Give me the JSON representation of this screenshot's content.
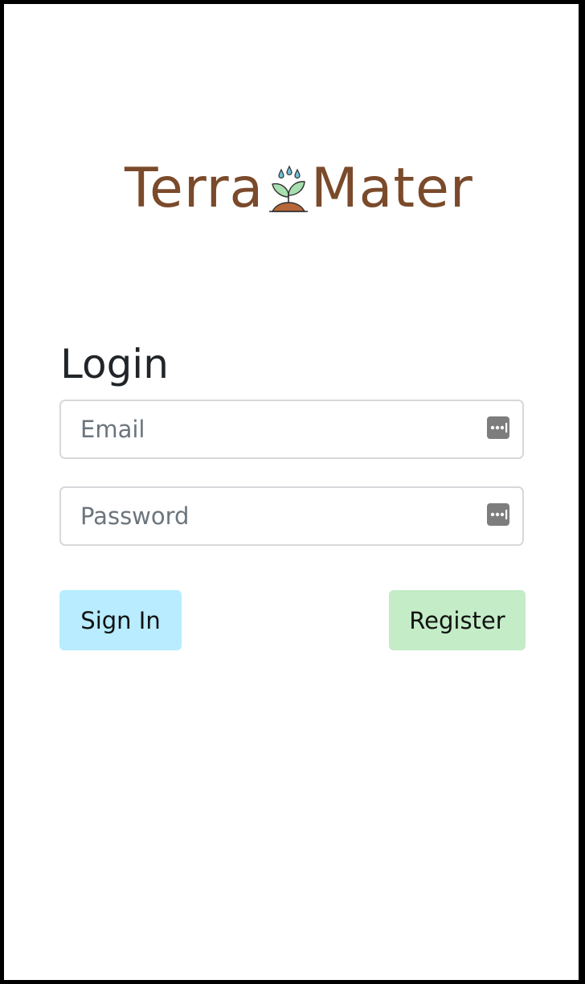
{
  "brand": {
    "word_left": "Terra",
    "word_right": "Mater",
    "logo_icon": "sprout-with-water-drops-icon"
  },
  "login": {
    "title": "Login",
    "email_placeholder": "Email",
    "email_value": "",
    "password_placeholder": "Password",
    "password_value": "",
    "field_icon": "password-manager-key-icon",
    "signin_label": "Sign In",
    "register_label": "Register"
  },
  "colors": {
    "brand_brown": "#7a4a2b",
    "leaf_green": "#9fd8a6",
    "drop_blue": "#6fc0d8",
    "signin_bg": "#b8ecfe",
    "register_bg": "#c3ecc7"
  }
}
